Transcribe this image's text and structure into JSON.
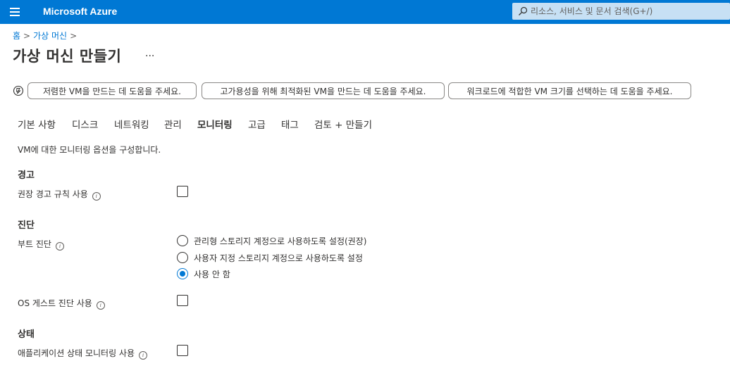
{
  "topbar": {
    "brand": "Microsoft Azure",
    "search_placeholder": "리소스, 서비스 및 문서 검색(G+/)",
    "color": "#0078d4"
  },
  "breadcrumb": {
    "home": "홈",
    "vm": "가상 머신"
  },
  "page": {
    "title": "가상 머신 만들기",
    "more": "..."
  },
  "suggestions": [
    "저렴한 VM을 만드는 데 도움을 주세요.",
    "고가용성을 위해 최적화된 VM을 만드는 데 도움을 주세요.",
    "워크로드에 적합한 VM 크기를 선택하는 데 도움을 주세요."
  ],
  "tabs": [
    "기본 사항",
    "디스크",
    "네트워킹",
    "관리",
    "모니터링",
    "고급",
    "태그",
    "검토 + 만들기"
  ],
  "active_tab": "모니터링",
  "description": "VM에 대한 모니터링 옵션을 구성합니다.",
  "alerts": {
    "heading": "경고",
    "recommended_label": "권장 경고 규칙 사용",
    "recommended_checked": false
  },
  "diagnostics": {
    "heading": "진단",
    "boot_label": "부트 진단",
    "options": [
      "관리형 스토리지 계정으로 사용하도록 설정(권장)",
      "사용자 지정 스토리지 계정으로 사용하도록 설정",
      "사용 안 함"
    ],
    "selected": "사용 안 함",
    "os_guest_label": "OS 게스트 진단 사용",
    "os_guest_checked": false
  },
  "health": {
    "heading": "상태",
    "app_health_label": "애플리케이션 상태 모니터링 사용",
    "app_health_checked": false
  },
  "icons": {
    "info": "i"
  }
}
